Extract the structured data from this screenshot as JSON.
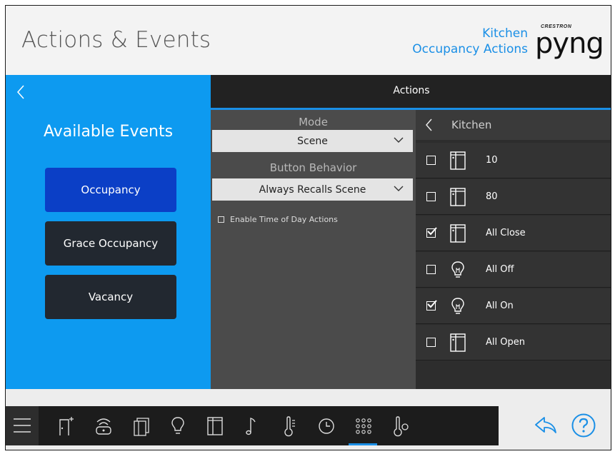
{
  "header": {
    "title": "Actions & Events",
    "context_line1": "Kitchen",
    "context_line2": "Occupancy Actions",
    "logo_small": "CRESTRON",
    "logo_big": "pyng"
  },
  "left": {
    "heading": "Available Events",
    "events": [
      {
        "label": "Occupancy",
        "active": true
      },
      {
        "label": "Grace Occupancy",
        "active": false
      },
      {
        "label": "Vacancy",
        "active": false
      }
    ]
  },
  "actions": {
    "title": "Actions",
    "mode_label": "Mode",
    "mode_value": "Scene",
    "behavior_label": "Button Behavior",
    "behavior_value": "Always Recalls Scene",
    "time_of_day_label": "Enable Time of Day Actions",
    "time_of_day_checked": false
  },
  "list": {
    "header": "Kitchen",
    "items": [
      {
        "label": "10",
        "checked": false,
        "icon": "shade-icon"
      },
      {
        "label": "80",
        "checked": false,
        "icon": "shade-icon"
      },
      {
        "label": "All Close",
        "checked": true,
        "icon": "shade-icon"
      },
      {
        "label": "All Off",
        "checked": false,
        "icon": "bulb-icon"
      },
      {
        "label": "All On",
        "checked": true,
        "icon": "bulb-icon"
      },
      {
        "label": "All Open",
        "checked": false,
        "icon": "shade-icon"
      }
    ]
  },
  "colors": {
    "accent": "#1a8fe6",
    "left_panel": "#0d9af0",
    "active_event": "#0b3fc6"
  }
}
